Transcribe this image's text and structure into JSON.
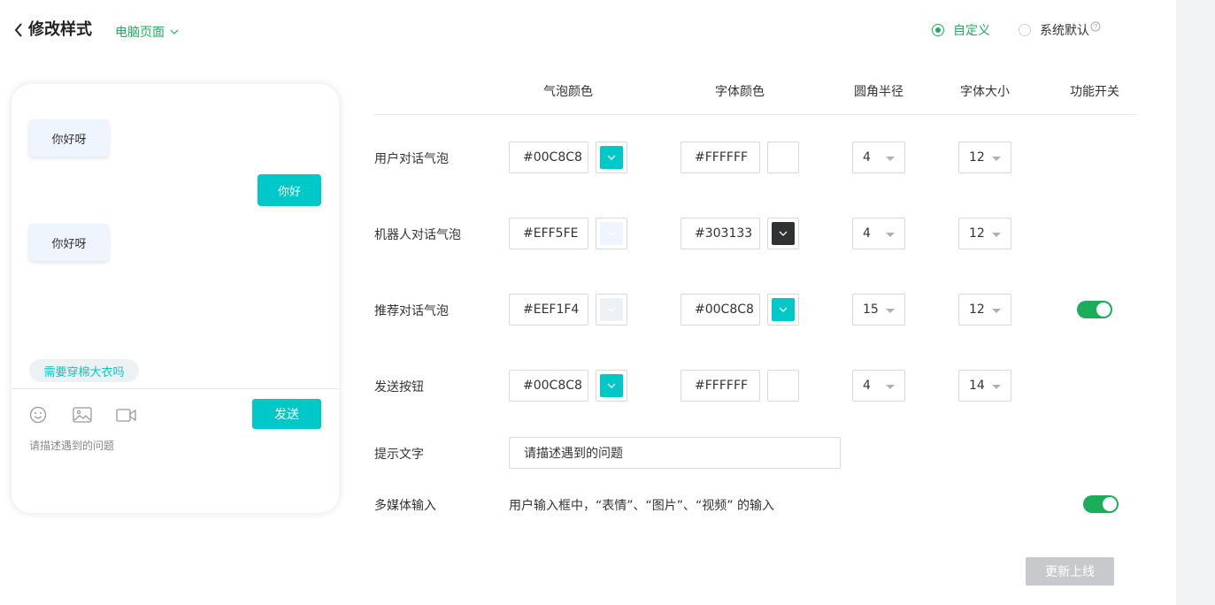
{
  "header": {
    "title": "修改样式",
    "page_select": "电脑页面"
  },
  "mode": {
    "custom_label": "自定义",
    "default_label": "系统默认",
    "selected": "custom"
  },
  "preview": {
    "robot_bubble_1": "你好呀",
    "user_bubble": "你好",
    "robot_bubble_2": "你好呀",
    "recommend_chip": "需要穿棉大衣吗",
    "send_label": "发送",
    "input_placeholder": "请描述遇到的问题"
  },
  "table": {
    "headers": {
      "bubble_color": "气泡颜色",
      "font_color": "字体颜色",
      "radius": "圆角半径",
      "font_size": "字体大小",
      "switch": "功能开关"
    },
    "rows": [
      {
        "label": "用户对话气泡",
        "bubble_color": "#00C8C8",
        "font_color": "#FFFFFF",
        "radius": "4",
        "font_size": "12",
        "has_switch": false
      },
      {
        "label": "机器人对话气泡",
        "bubble_color": "#EFF5FE",
        "font_color": "#303133",
        "radius": "4",
        "font_size": "12",
        "has_switch": false
      },
      {
        "label": "推荐对话气泡",
        "bubble_color": "#EEF1F4",
        "font_color": "#00C8C8",
        "radius": "15",
        "font_size": "12",
        "has_switch": true,
        "switch_on": true
      },
      {
        "label": "发送按钮",
        "bubble_color": "#00C8C8",
        "font_color": "#FFFFFF",
        "radius": "4",
        "font_size": "14",
        "has_switch": false
      }
    ]
  },
  "hint": {
    "label": "提示文字",
    "value": "请描述遇到的问题"
  },
  "media": {
    "label": "多媒体输入",
    "desc": "用户输入框中，“表情”、“图片”、“视频” 的输入",
    "switch_on": true
  },
  "footer": {
    "update_label": "更新上线"
  },
  "colors": {
    "accent_green": "#1aad5a",
    "teal": "#00c8c8",
    "disabled_gray": "#c8c9cc"
  }
}
